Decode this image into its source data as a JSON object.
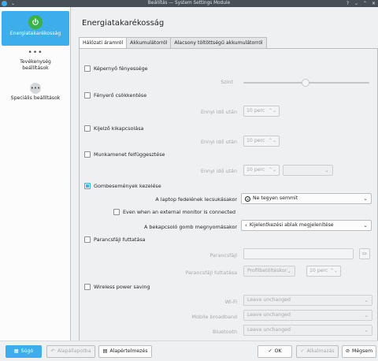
{
  "window": {
    "title": "Beállítás — System Settings Module"
  },
  "sidebar": {
    "items": [
      {
        "label": "Energiatakarékosság",
        "icon": "power-icon",
        "active": true
      },
      {
        "label": "Tevékenység beállítások",
        "icon": "dots-icon",
        "active": false
      },
      {
        "label": "Speciális beállítások",
        "icon": "dots-icon",
        "active": false
      }
    ]
  },
  "main": {
    "title": "Energiatakarékosság",
    "tabs": [
      "Hálózati áramról",
      "Akkumulátorról",
      "Alacsony töltöttségű akkumulátorról"
    ]
  },
  "settings": {
    "screen_brightness": {
      "label": "Képernyő fényessége",
      "checked": false,
      "sub_label": "Szint",
      "level": 0.5
    },
    "dim_screen": {
      "label": "Fényerő csökkentése",
      "checked": false,
      "sub_label": "Ennyi idő után",
      "value": "10 perc"
    },
    "screen_off": {
      "label": "Kijelző kikapcsolása",
      "checked": false,
      "sub_label": "Ennyi idő után",
      "value": "10 perc"
    },
    "suspend": {
      "label": "Munkamenet felfüggesztése",
      "checked": false,
      "sub_label": "Ennyi idő után",
      "value": "10 perc",
      "action": ""
    },
    "buttons": {
      "label": "Gombesemények kezelése",
      "checked": true,
      "lid_label": "A laptop fedelének lecsukásakor",
      "lid_value": "Ne tegyen semmit",
      "external_monitor_label": "Even when an external monitor is connected",
      "power_button_label": "A bekapcsoló gomb megnyomásakor",
      "power_button_value": "Kijelentkezési ablak megjelenítése"
    },
    "script": {
      "label": "Parancsfájl futtatása",
      "checked": false,
      "script_label": "Parancsfájl",
      "run_label": "Parancsfájl futtatása",
      "run_value": "Profilbetöltéskor",
      "after_value": "10 perc"
    },
    "wireless": {
      "label": "Wireless power saving",
      "checked": false,
      "wifi_label": "Wi-Fi",
      "wifi_value": "Leave unchanged",
      "mobile_label": "Mobile broadband",
      "mobile_value": "Leave unchanged",
      "bt_label": "Bluetooth",
      "bt_value": "Leave unchanged"
    }
  },
  "footer": {
    "help": "Súgó",
    "defaults_reset": "Alapállapotba",
    "defaults": "Alapértelmezés",
    "ok": "OK",
    "apply": "Alkalmazás",
    "cancel": "Mégsem"
  },
  "colors": {
    "accent": "#3daee9",
    "titlebar": "#475057",
    "power_green": "#3bb14a"
  }
}
